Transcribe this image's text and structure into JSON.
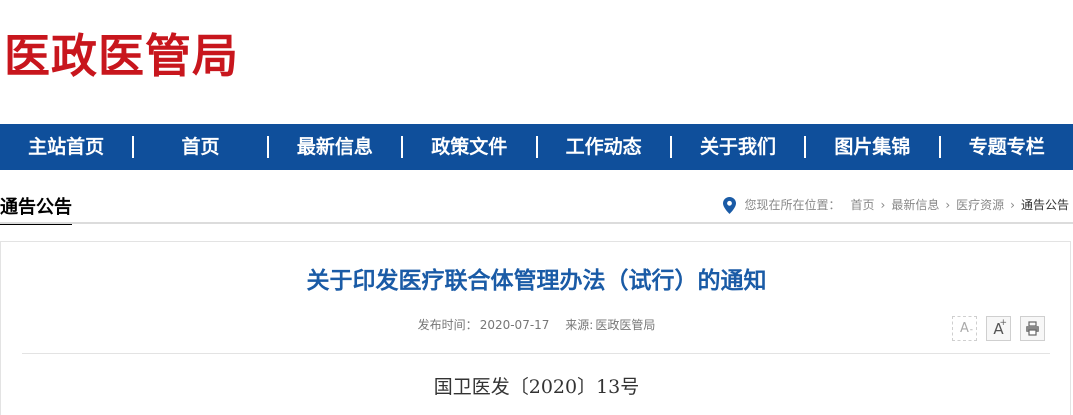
{
  "site": {
    "logo_text": "医政医管局",
    "brand_color": "#c8161d",
    "nav_color": "#0f4f9b"
  },
  "nav": {
    "items": [
      {
        "label": "主站首页"
      },
      {
        "label": "首页"
      },
      {
        "label": "最新信息"
      },
      {
        "label": "政策文件"
      },
      {
        "label": "工作动态"
      },
      {
        "label": "关于我们"
      },
      {
        "label": "图片集锦"
      },
      {
        "label": "专题专栏"
      }
    ]
  },
  "section": {
    "title": "通告公告"
  },
  "breadcrumb": {
    "icon": "location-pin-icon",
    "prefix": "您现在所在位置：",
    "items": [
      {
        "label": "首页"
      },
      {
        "label": "最新信息"
      },
      {
        "label": "医疗资源"
      },
      {
        "label": "通告公告"
      }
    ]
  },
  "article": {
    "title": "关于印发医疗联合体管理办法（试行）的通知",
    "publish_label": "发布时间：",
    "publish_date": "2020-07-17",
    "source_label": "来源:",
    "source": "医政医管局",
    "doc_number": "国卫医发〔2020〕13号"
  },
  "tools": {
    "decrease_font_label": "A",
    "decrease_font_sign": "-",
    "increase_font_label": "A",
    "increase_font_sign": "+",
    "print_icon": "printer-icon"
  }
}
